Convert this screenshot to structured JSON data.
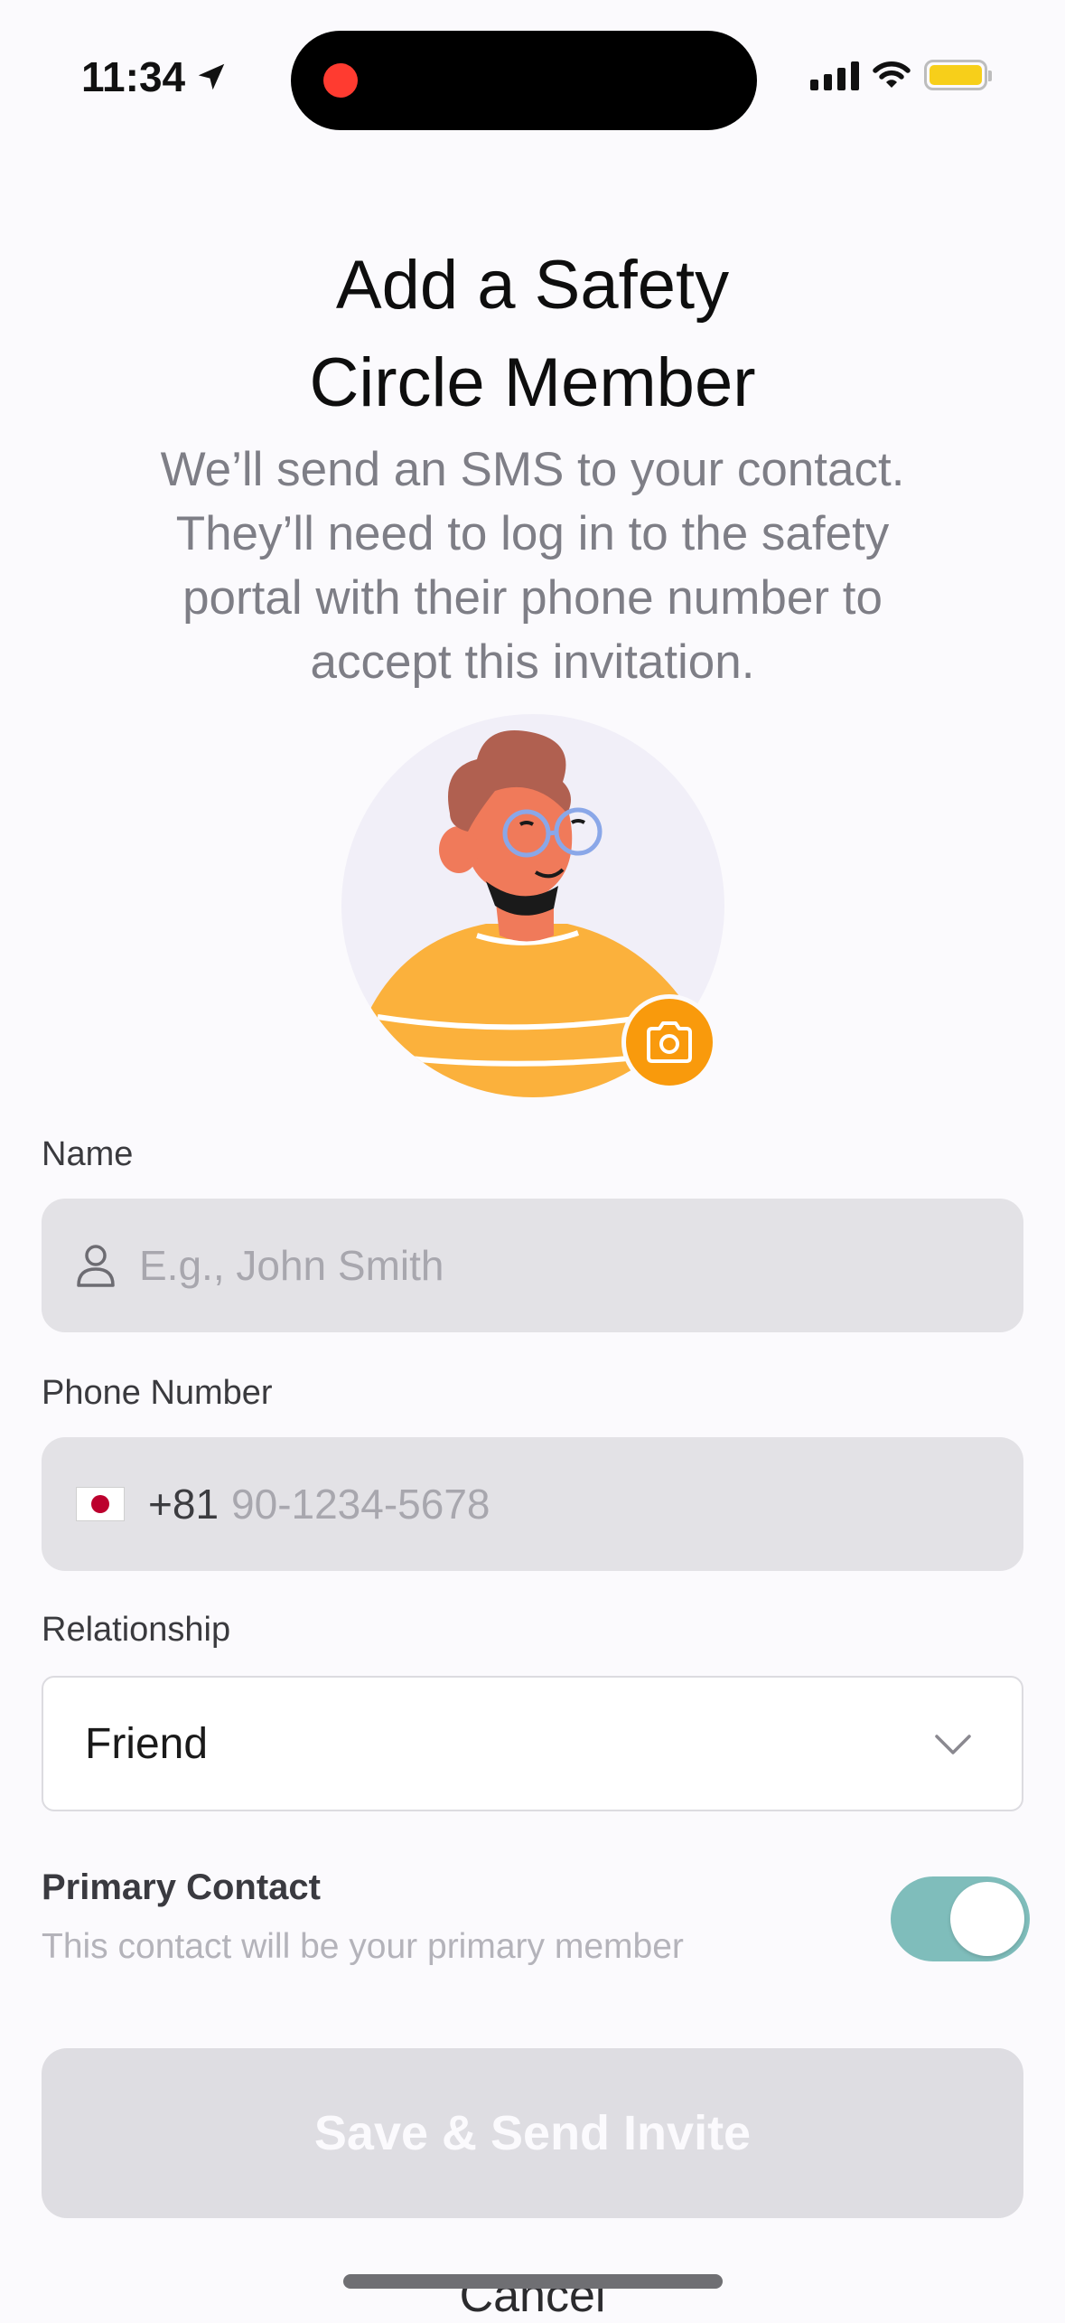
{
  "status_bar": {
    "time": "11:34",
    "battery_color": "#f7cf1a",
    "recording_color": "#ff3b30"
  },
  "header": {
    "title_line1": "Add a Safety",
    "title_line2": "Circle Member",
    "subtitle_line1": "We’ll send an SMS to your contact.",
    "subtitle_line2": "They’ll need to log in to the safety",
    "subtitle_line3": "portal with their phone number to",
    "subtitle_line4": "accept this invitation."
  },
  "avatar": {
    "camera_icon": "camera-icon",
    "badge_color": "#f99a0c"
  },
  "form": {
    "name": {
      "label": "Name",
      "placeholder": "E.g., John Smith",
      "icon": "person-icon"
    },
    "phone": {
      "label": "Phone Number",
      "country_flag": "japan-flag-icon",
      "dial_code": "+81",
      "placeholder": "90-1234-5678"
    },
    "relationship": {
      "label": "Relationship",
      "selected": "Friend",
      "icon": "chevron-down-icon"
    },
    "primary_contact": {
      "title": "Primary Contact",
      "description": "This contact will be your primary member",
      "enabled": true,
      "toggle_color": "#7fbdbb"
    }
  },
  "actions": {
    "save_label": "Save & Send Invite",
    "cancel_label": "Cancel"
  }
}
